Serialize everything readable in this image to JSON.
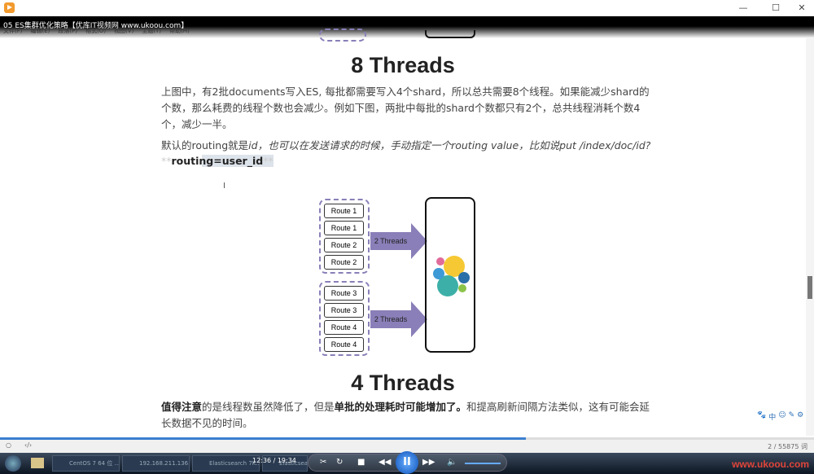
{
  "window": {
    "title": "05 ES集群优化策略【优库IT视频网 www.ukoou.com】",
    "minimize": "—",
    "maximize": "☐",
    "close": "✕"
  },
  "menu": [
    "文件(F)",
    "编辑(E)",
    "段落(P)",
    "格式(O)",
    "视图(V)",
    "主题(T)",
    "帮助(H)"
  ],
  "doc": {
    "heading1": "8 Threads",
    "para1": "上图中，有2批documents写入ES, 每批都需要写入4个shard，所以总共需要8个线程。如果能减少shard的个数，那么耗费的线程个数也会减少。例如下图，两批中每批的shard个数都只有2个，总共线程消耗个数4个，减少一半。",
    "para2_prefix": "默认的routing就是",
    "para2_italic": "id，也可以在发送请求的时候，手动指定一个routing value，比如说put /index/doc/id?",
    "para3_stars_open": "**",
    "para3_code": "routing=user_id",
    "para3_stars_close": "**",
    "diagram": {
      "routes": [
        "Route 1",
        "Route 1",
        "Route 2",
        "Route 2",
        "Route 3",
        "Route 3",
        "Route 4",
        "Route 4"
      ],
      "arrow_labels": [
        "2 Threads",
        "2 Threads"
      ],
      "accent": "#8a7fb8"
    },
    "heading2": "4 Threads",
    "para4_bold1": "值得注意",
    "para4_mid": "的是线程数虽然降低了，但是",
    "para4_bold2": "单批的处理耗时可能增加了。",
    "para4_end": "和提高刷新间隔方法类似，这有可能会延长数据不见的时间。"
  },
  "tools": [
    "🐾",
    "中",
    "☺",
    "✎",
    "⚙"
  ],
  "status": {
    "word_count": "2 / 55875 词"
  },
  "player": {
    "time": "12:36 / 19:34",
    "progress_percent": 64.6,
    "brand": "www.ukoou.com"
  },
  "taskbar": [
    "CentOS 7 64 位 ...",
    "192.168.211.136...",
    "Elasticsearch 7K...",
    "Elasticsearch 7 pr..."
  ]
}
